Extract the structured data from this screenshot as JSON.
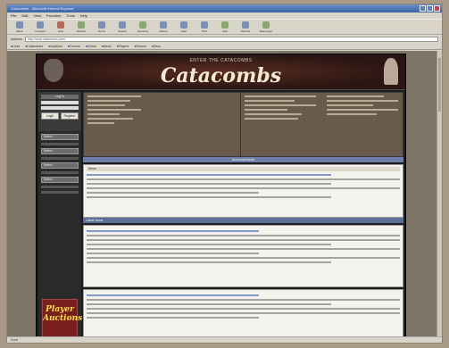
{
  "browser": {
    "title": "Catacombs - Microsoft Internet Explorer",
    "menu": [
      "File",
      "Edit",
      "View",
      "Favorites",
      "Tools",
      "Help"
    ],
    "toolbar": [
      {
        "label": "Back",
        "icon": "back-arrow-icon"
      },
      {
        "label": "Forward",
        "icon": "forward-arrow-icon"
      },
      {
        "label": "Stop",
        "icon": "stop-icon"
      },
      {
        "label": "Refresh",
        "icon": "refresh-icon"
      },
      {
        "label": "Home",
        "icon": "home-icon"
      },
      {
        "label": "Search",
        "icon": "search-icon"
      },
      {
        "label": "Favorites",
        "icon": "favorites-icon"
      },
      {
        "label": "History",
        "icon": "history-icon"
      },
      {
        "label": "Mail",
        "icon": "mail-icon"
      },
      {
        "label": "Print",
        "icon": "print-icon"
      },
      {
        "label": "Edit",
        "icon": "edit-icon"
      },
      {
        "label": "Discuss",
        "icon": "discuss-icon"
      },
      {
        "label": "Messenger",
        "icon": "messenger-icon"
      }
    ],
    "address_label": "Address",
    "address_value": "http://www.catacombs.com/",
    "links": [
      "Links",
      "Catacombs",
      "Auctions",
      "Forums",
      "Guilds",
      "News",
      "Players",
      "Search",
      "Shop"
    ],
    "status": "Done"
  },
  "site": {
    "subtitle": "ENTER THE CATACOMBS",
    "title": "Catacombs",
    "login": {
      "heading": "Log In",
      "login_button": "Login",
      "register_button": "Register"
    },
    "nav_selects": [
      "Select",
      "Select",
      "Select",
      "Select"
    ],
    "ad_text": "Player Auctions",
    "news_bar": "Announcements",
    "post_heading": "News",
    "post2_heading": "Latest News"
  }
}
